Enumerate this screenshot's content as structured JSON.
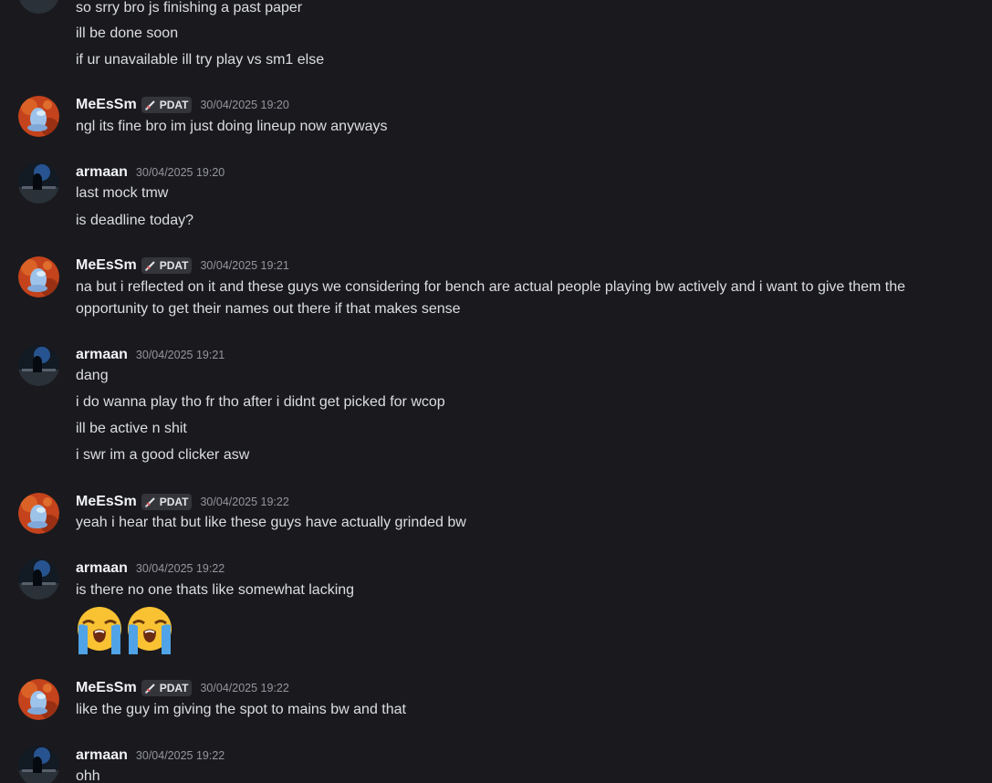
{
  "colors": {
    "background": "#1a1a1e",
    "username": "#f2f3f5",
    "message_text": "#dbdee1",
    "timestamp": "#94959c",
    "tag_background": "#34353b"
  },
  "top_lines": [
    "so srry bro js finishing a past paper",
    "ill be done soon",
    "if ur unavailable ill try play vs sm1 else"
  ],
  "messages": [
    {
      "author": "MeEsSm",
      "tag": "PDAT",
      "tag_icon": "sword-icon",
      "timestamp": "30/04/2025 19:20",
      "lines": [
        "ngl its fine bro im just doing lineup now anyways"
      ]
    },
    {
      "author": "armaan",
      "timestamp": "30/04/2025 19:20",
      "lines": [
        "last mock tmw",
        "is deadline today?"
      ]
    },
    {
      "author": "MeEsSm",
      "tag": "PDAT",
      "tag_icon": "sword-icon",
      "timestamp": "30/04/2025 19:21",
      "lines": [
        "na but i reflected on it and these guys we considering for bench are actual people playing bw actively and i want to give them the opportunity to get their names out there if that makes sense"
      ]
    },
    {
      "author": "armaan",
      "timestamp": "30/04/2025 19:21",
      "lines": [
        "dang",
        "i do wanna play tho fr tho after i didnt get picked for wcop",
        "ill be active n shit",
        "i swr im a good clicker asw"
      ]
    },
    {
      "author": "MeEsSm",
      "tag": "PDAT",
      "tag_icon": "sword-icon",
      "timestamp": "30/04/2025 19:22",
      "lines": [
        "yeah i hear that but like these guys have actually grinded bw"
      ]
    },
    {
      "author": "armaan",
      "timestamp": "30/04/2025 19:22",
      "lines": [
        "is there no one thats like somewhat lacking"
      ],
      "emojis": [
        "loudly-crying-face-emoji",
        "loudly-crying-face-emoji"
      ]
    },
    {
      "author": "MeEsSm",
      "tag": "PDAT",
      "tag_icon": "sword-icon",
      "timestamp": "30/04/2025 19:22",
      "lines": [
        "like the guy im giving the spot to mains bw and that"
      ]
    },
    {
      "author": "armaan",
      "timestamp": "30/04/2025 19:22",
      "lines": [
        "ohh"
      ]
    }
  ]
}
